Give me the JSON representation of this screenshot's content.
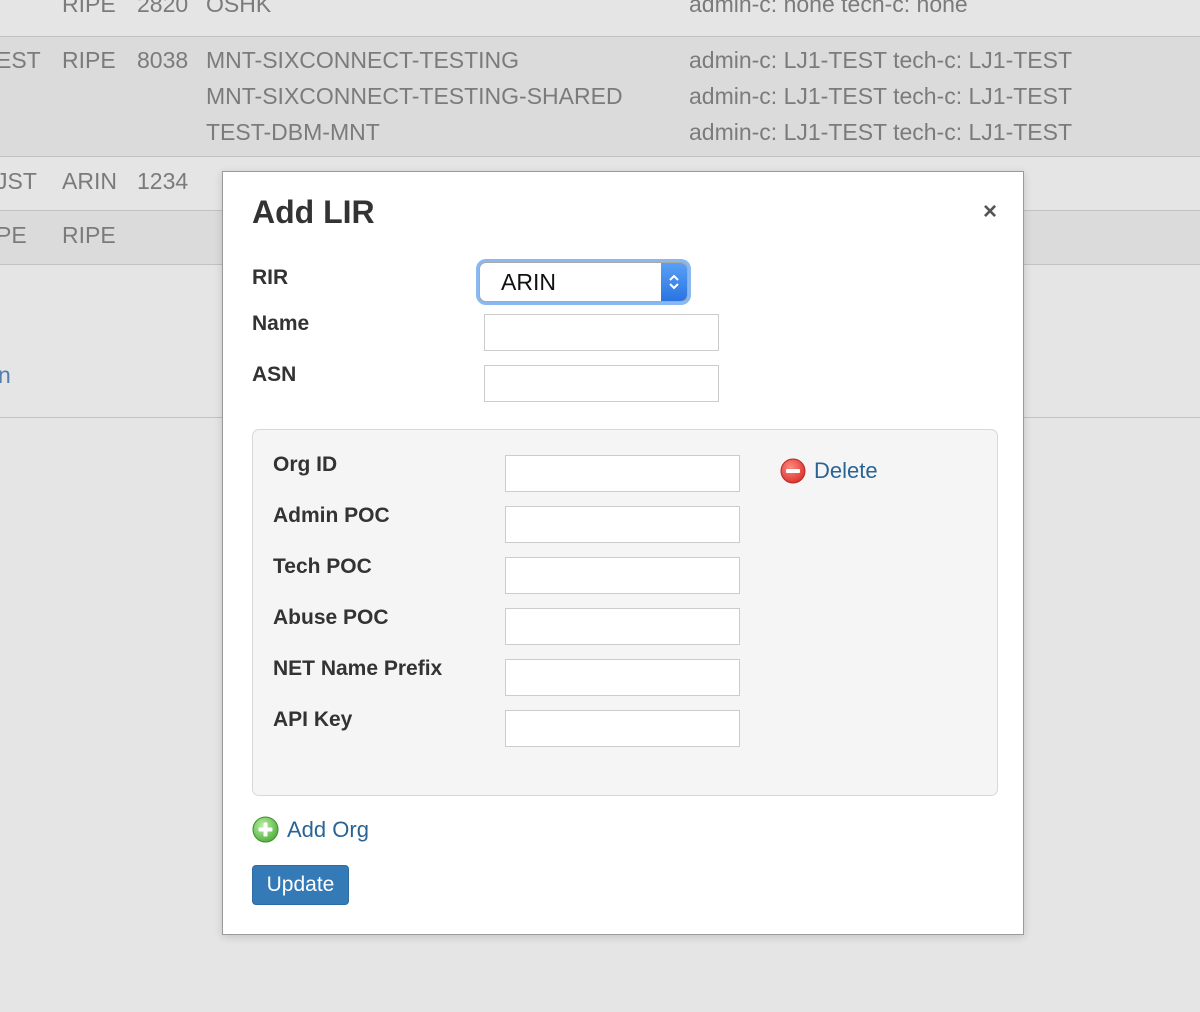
{
  "background_table": {
    "rows": [
      {
        "col_a": "",
        "rir": "RIPE",
        "asn": "2820",
        "maintainers": [
          "OSHK"
        ],
        "contacts": [
          "admin-c: none tech-c: none"
        ]
      },
      {
        "col_a": "EST",
        "rir": "RIPE",
        "asn": "8038",
        "maintainers": [
          "MNT-SIXCONNECT-TESTING",
          "MNT-SIXCONNECT-TESTING-SHARED",
          "TEST-DBM-MNT"
        ],
        "contacts": [
          "admin-c: LJ1-TEST tech-c: LJ1-TEST",
          "admin-c: LJ1-TEST tech-c: LJ1-TEST",
          "admin-c: LJ1-TEST tech-c: LJ1-TEST"
        ]
      },
      {
        "col_a": "JST",
        "rir": "ARIN",
        "asn": "1234",
        "maintainers": [],
        "contacts": []
      },
      {
        "col_a": "PE",
        "rir": "RIPE",
        "asn": "",
        "maintainers": [],
        "contacts": []
      }
    ],
    "link_fragment": "n"
  },
  "modal": {
    "title": "Add LIR",
    "close_symbol": "×",
    "fields": {
      "rir": {
        "label": "RIR",
        "selected": "ARIN"
      },
      "name": {
        "label": "Name",
        "value": ""
      },
      "asn": {
        "label": "ASN",
        "value": ""
      }
    },
    "org": {
      "fields": [
        {
          "label": "Org ID",
          "value": ""
        },
        {
          "label": "Admin POC",
          "value": ""
        },
        {
          "label": "Tech POC",
          "value": ""
        },
        {
          "label": "Abuse POC",
          "value": ""
        },
        {
          "label": "NET Name Prefix",
          "value": ""
        },
        {
          "label": "API Key",
          "value": ""
        }
      ],
      "delete_label": "Delete"
    },
    "add_org_label": "Add Org",
    "update_label": "Update"
  },
  "colors": {
    "link": "#2a6496",
    "primary_button": "#337ab7",
    "delete_icon": "#d9534f",
    "add_icon": "#5cb85c"
  }
}
